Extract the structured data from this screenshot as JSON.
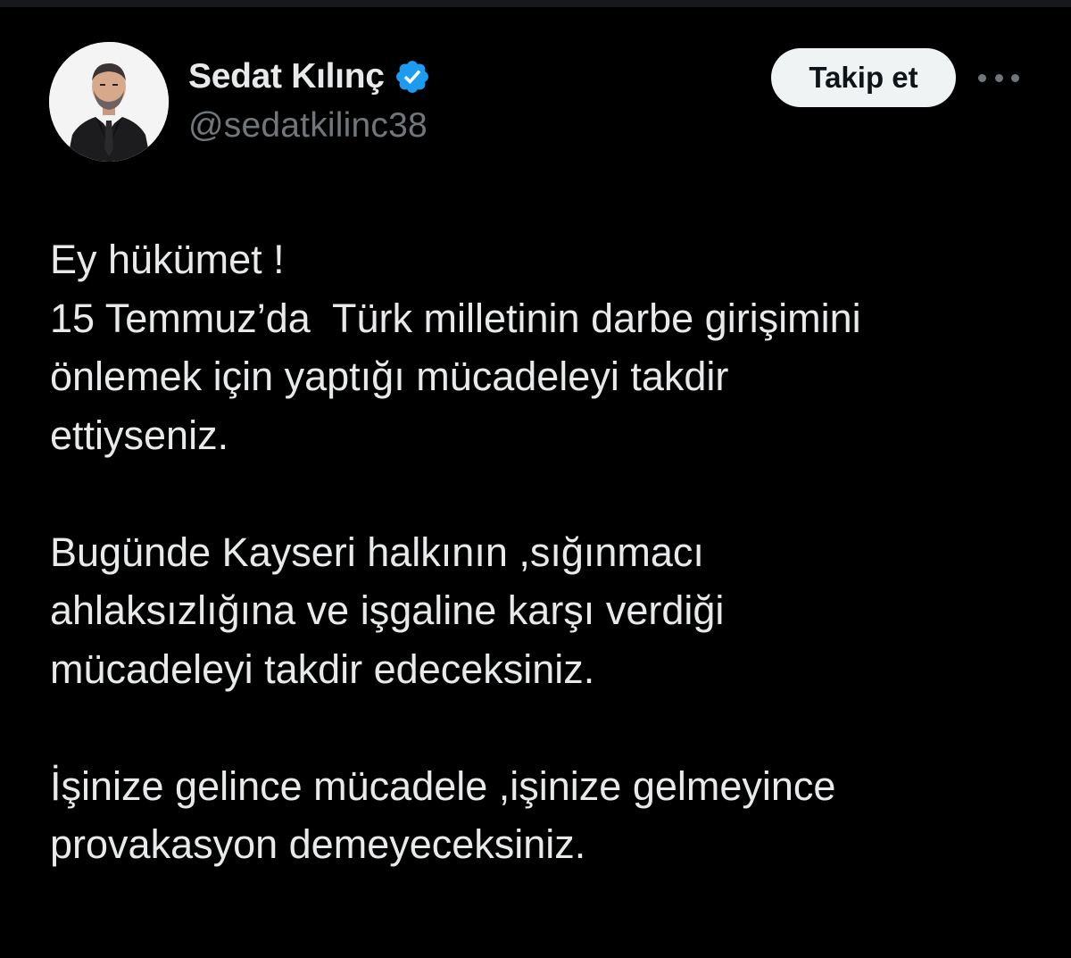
{
  "author": {
    "display_name": "Sedat Kılınç",
    "handle": "@sedatkilinc38",
    "verified": true,
    "verified_color": "#1d9bf0"
  },
  "actions": {
    "follow_label": "Takip et",
    "more_icon": "more-horizontal-icon"
  },
  "tweet": {
    "lines": [
      "Ey hükümet !",
      "15 Temmuz’da  Türk milletinin darbe girişimini",
      "önlemek için yaptığı mücadeleyi takdir",
      "ettiyseniz.",
      "",
      "Bugünde Kayseri halkının ,sığınmacı",
      "ahlaksızlığına ve işgaline karşı verdiği",
      "mücadeleyi takdir edeceksiniz.",
      "",
      "İşinize gelince mücadele ,işinize gelmeyince",
      "provakasyon demeyeceksiniz."
    ]
  },
  "colors": {
    "background": "#000000",
    "text": "#e7e9ea",
    "secondary_text": "#71767b",
    "button_bg": "#eff3f4",
    "button_text": "#0f1419"
  }
}
